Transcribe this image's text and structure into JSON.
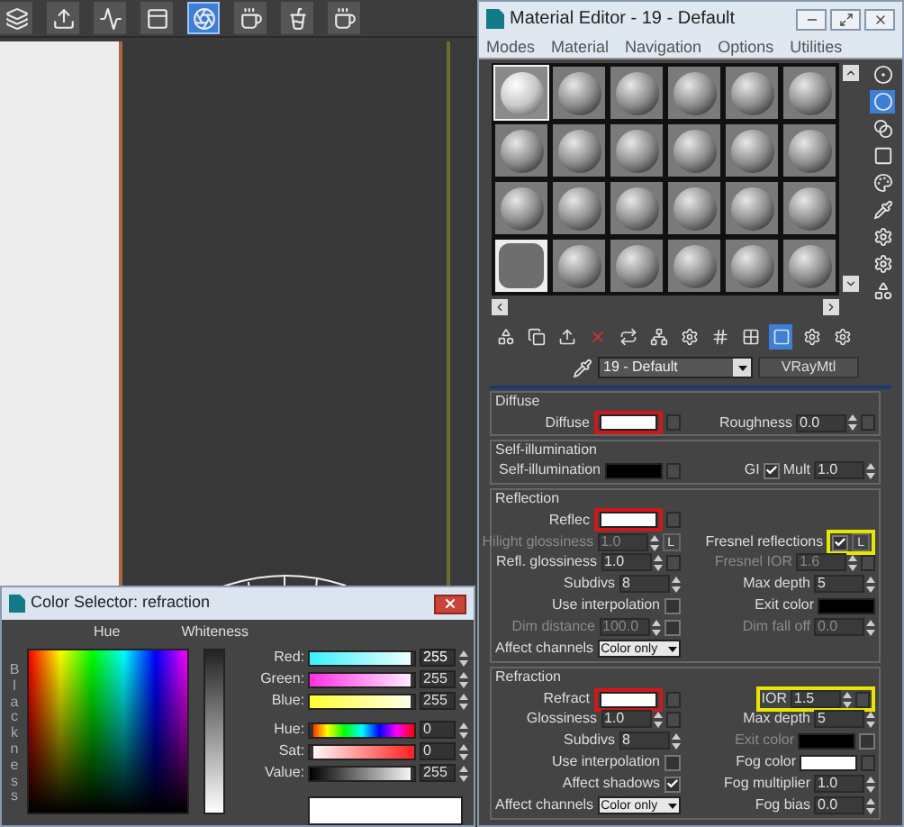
{
  "toolbar": [
    {
      "selected": false
    },
    {
      "selected": false
    },
    {
      "selected": false
    },
    {
      "selected": false
    },
    {
      "selected": true
    },
    {
      "selected": false
    },
    {
      "selected": false
    },
    {
      "selected": false
    }
  ],
  "material_editor": {
    "title": "Material Editor - 19 - Default",
    "menu": [
      "Modes",
      "Material",
      "Navigation",
      "Options",
      "Utilities"
    ],
    "slots": [
      {
        "kind": "sphere",
        "selected": true
      },
      {
        "kind": "sphere",
        "selected": false
      },
      {
        "kind": "sphere",
        "selected": false
      },
      {
        "kind": "sphere",
        "selected": false
      },
      {
        "kind": "sphere",
        "selected": false
      },
      {
        "kind": "sphere",
        "selected": false
      },
      {
        "kind": "sphere",
        "selected": false
      },
      {
        "kind": "sphere",
        "selected": false
      },
      {
        "kind": "sphere",
        "selected": false
      },
      {
        "kind": "sphere",
        "selected": false
      },
      {
        "kind": "sphere",
        "selected": false
      },
      {
        "kind": "sphere",
        "selected": false
      },
      {
        "kind": "sphere",
        "selected": false
      },
      {
        "kind": "sphere",
        "selected": false
      },
      {
        "kind": "sphere",
        "selected": false
      },
      {
        "kind": "sphere",
        "selected": false
      },
      {
        "kind": "sphere",
        "selected": false
      },
      {
        "kind": "sphere",
        "selected": false
      },
      {
        "kind": "empty",
        "selected": false
      },
      {
        "kind": "sphere",
        "selected": false
      },
      {
        "kind": "sphere",
        "selected": false
      },
      {
        "kind": "sphere",
        "selected": false
      },
      {
        "kind": "sphere",
        "selected": false
      },
      {
        "kind": "sphere",
        "selected": false
      }
    ],
    "side_tools": [
      {
        "selected": false
      },
      {
        "selected": true
      },
      {
        "selected": false
      },
      {
        "selected": false
      },
      {
        "selected": false
      },
      {
        "selected": false
      },
      {
        "selected": false
      },
      {
        "selected": false
      },
      {
        "selected": false
      }
    ],
    "bottom_tools": [
      {
        "selected": false
      },
      {
        "selected": false
      },
      {
        "selected": false
      },
      {
        "selected": false
      },
      {
        "selected": false
      },
      {
        "selected": false
      },
      {
        "selected": false
      },
      {
        "selected": false
      },
      {
        "selected": false
      },
      {
        "selected": true
      },
      {
        "selected": false
      },
      {
        "selected": false
      }
    ],
    "material_name": "19 - Default",
    "material_type": "VRayMtl",
    "groups": [
      {
        "title": "Diffuse",
        "rows": [
          {
            "left": [
              {
                "kind": "label",
                "text": "Diffuse"
              },
              {
                "kind": "group",
                "color": "#d01818",
                "items": [
                  {
                    "kind": "swatch",
                    "color": "#ffffff"
                  }
                ]
              },
              {
                "kind": "map"
              }
            ],
            "right": [
              {
                "kind": "label",
                "text": "Roughness"
              },
              {
                "kind": "spinner",
                "value": "0.0"
              },
              {
                "kind": "map"
              }
            ]
          }
        ]
      },
      {
        "title": "Self-illumination",
        "rows": [
          {
            "left": [
              {
                "kind": "label",
                "text": "Self-illumination"
              },
              {
                "kind": "swatch",
                "color": "#000000"
              },
              {
                "kind": "map"
              }
            ],
            "right": [
              {
                "kind": "label",
                "text": "GI"
              },
              {
                "kind": "checkbox",
                "checked": true
              },
              {
                "kind": "label",
                "text": "Mult"
              },
              {
                "kind": "spinner",
                "value": "1.0"
              }
            ]
          }
        ]
      },
      {
        "title": "Reflection",
        "rows": [
          {
            "left": [
              {
                "kind": "label",
                "text": "Reflec"
              },
              {
                "kind": "group",
                "color": "#d01818",
                "items": [
                  {
                    "kind": "swatch",
                    "color": "#ffffff"
                  }
                ]
              },
              {
                "kind": "map"
              }
            ],
            "right": []
          },
          {
            "left": [
              {
                "kind": "label",
                "text": "Hilight glossiness",
                "disabled": true
              },
              {
                "kind": "spinner",
                "value": "1.0",
                "disabled": true
              },
              {
                "kind": "button",
                "text": "L"
              }
            ],
            "right": [
              {
                "kind": "label",
                "text": "Fresnel reflections"
              },
              {
                "kind": "group",
                "color": "#e6e600",
                "items": [
                  {
                    "kind": "checkbox",
                    "checked": true
                  },
                  {
                    "kind": "button",
                    "text": "L"
                  }
                ]
              }
            ]
          },
          {
            "left": [
              {
                "kind": "label",
                "text": "Refl. glossiness"
              },
              {
                "kind": "spinner",
                "value": "1.0"
              },
              {
                "kind": "map"
              }
            ],
            "right": [
              {
                "kind": "label",
                "text": "Fresnel IOR",
                "disabled": true
              },
              {
                "kind": "spinner",
                "value": "1.6",
                "disabled": true
              },
              {
                "kind": "map"
              }
            ]
          },
          {
            "left": [
              {
                "kind": "label",
                "text": "Subdivs"
              },
              {
                "kind": "spinner",
                "value": "8"
              }
            ],
            "right": [
              {
                "kind": "label",
                "text": "Max depth"
              },
              {
                "kind": "spinner",
                "value": "5"
              }
            ]
          },
          {
            "left": [
              {
                "kind": "label",
                "text": "Use interpolation"
              },
              {
                "kind": "checkbox",
                "checked": false
              }
            ],
            "right": [
              {
                "kind": "label",
                "text": "Exit color"
              },
              {
                "kind": "swatch",
                "color": "#000000"
              }
            ]
          },
          {
            "left": [
              {
                "kind": "label",
                "text": "Dim distance",
                "disabled": true
              },
              {
                "kind": "spinner",
                "value": "100.0",
                "disabled": true
              },
              {
                "kind": "checkbox",
                "checked": false
              }
            ],
            "right": [
              {
                "kind": "label",
                "text": "Dim fall off",
                "disabled": true
              },
              {
                "kind": "spinner",
                "value": "0.0",
                "disabled": true
              }
            ]
          },
          {
            "left": [
              {
                "kind": "label",
                "text": "Affect channels"
              },
              {
                "kind": "dropdown",
                "value": "Color only"
              }
            ],
            "right": []
          }
        ]
      },
      {
        "title": "Refraction",
        "rows": [
          {
            "left": [
              {
                "kind": "label",
                "text": "Refract"
              },
              {
                "kind": "group",
                "color": "#d01818",
                "items": [
                  {
                    "kind": "swatch",
                    "color": "#ffffff"
                  }
                ]
              },
              {
                "kind": "map"
              }
            ],
            "right": [
              {
                "kind": "group",
                "color": "#e6e600",
                "items": [
                  {
                    "kind": "label",
                    "text": "IOR"
                  },
                  {
                    "kind": "spinner",
                    "value": "1.5"
                  },
                  {
                    "kind": "map"
                  }
                ]
              }
            ]
          },
          {
            "left": [
              {
                "kind": "label",
                "text": "Glossiness"
              },
              {
                "kind": "spinner",
                "value": "1.0"
              },
              {
                "kind": "map"
              }
            ],
            "right": [
              {
                "kind": "label",
                "text": "Max depth"
              },
              {
                "kind": "spinner",
                "value": "5"
              }
            ]
          },
          {
            "left": [
              {
                "kind": "label",
                "text": "Subdivs"
              },
              {
                "kind": "spinner",
                "value": "8"
              }
            ],
            "right": [
              {
                "kind": "label",
                "text": "Exit color",
                "disabled": true
              },
              {
                "kind": "swatch",
                "color": "#000000"
              },
              {
                "kind": "checkbox",
                "checked": false
              }
            ]
          },
          {
            "left": [
              {
                "kind": "label",
                "text": "Use interpolation"
              },
              {
                "kind": "checkbox",
                "checked": false
              }
            ],
            "right": [
              {
                "kind": "label",
                "text": "Fog color"
              },
              {
                "kind": "swatch",
                "color": "#ffffff"
              },
              {
                "kind": "map"
              }
            ]
          },
          {
            "left": [
              {
                "kind": "label",
                "text": "Affect shadows"
              },
              {
                "kind": "checkbox",
                "checked": true
              }
            ],
            "right": [
              {
                "kind": "label",
                "text": "Fog multiplier"
              },
              {
                "kind": "spinner",
                "value": "1.0"
              }
            ]
          },
          {
            "left": [
              {
                "kind": "label",
                "text": "Affect channels"
              },
              {
                "kind": "dropdown",
                "value": "Color only"
              }
            ],
            "right": [
              {
                "kind": "label",
                "text": "Fog bias"
              },
              {
                "kind": "spinner",
                "value": "0.0"
              }
            ]
          }
        ]
      }
    ]
  },
  "color_selector": {
    "title": "Color Selector: refraction",
    "hue_label": "Hue",
    "whiteness_label": "Whiteness",
    "blackness_label": "Blackness",
    "channels": [
      {
        "name": "Red:",
        "level": 1,
        "value": "255",
        "selected": true
      },
      {
        "name": "Green:",
        "level": 1,
        "value": "255",
        "selected": false
      },
      {
        "name": "Blue:",
        "level": 1,
        "value": "255",
        "selected": false
      },
      {
        "name": "Hue:",
        "level": 0,
        "value": "0",
        "selected": false
      },
      {
        "name": "Sat:",
        "level": 0,
        "value": "0",
        "selected": false
      },
      {
        "name": "Value:",
        "level": 1,
        "value": "255",
        "selected": false
      }
    ]
  }
}
